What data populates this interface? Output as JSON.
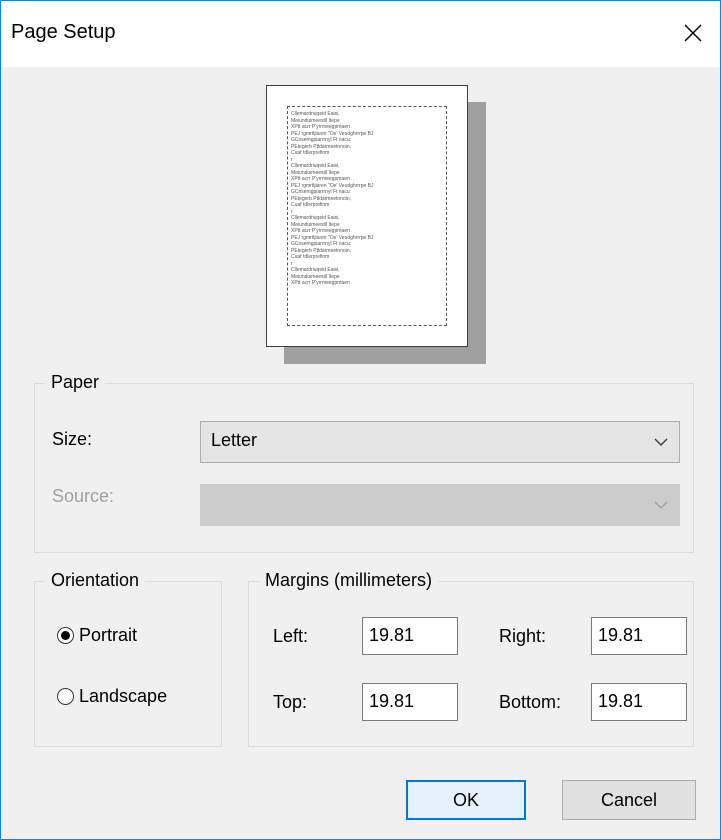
{
  "window": {
    "title": "Page Setup"
  },
  "preview": {
    "sample_lines": [
      "Cllemardriuqeid Eaisi,",
      "Meiunduimeestil Itepe",
      "XPtt acrr P'yrrmeegpmaen",
      "PEJ rgmrtljiaren \"Oe' Veudghrrrpe BJ",
      "GCnsemgpiarrrnyl Ft nacu:",
      "PEtegerb Ptldarmeetnnoin,",
      "Cuaf Idlerprefinm",
      "r",
      "Cllemardriuqeid Eaisi,",
      "Meiunduimeestil Itepe",
      "XPtt acrr P'yrrmeegpmaen",
      "PEJ rgmrtljiaren \"Oe' Veudghrrrpe BJ",
      "GCnsemgpiarrrnyl Ft nacu:",
      "PEtegerb Ptldarmeetnnoin,",
      "Cuaf Idlerprefinm",
      "r",
      "Cllemardriuqeid Eaisi,",
      "Meiunduimeestil Itepe",
      "XPtt acrr P'yrrmeegpmaen",
      "PEJ rgmrtljiaren \"Oe' Veudghrrrpe BJ",
      "GCnsemgpiarrrnyl Ft nacu:",
      "PEtegerb Ptldarmeetnnoin,",
      "Cuaf Idlerprefinm",
      "r",
      "Cllemardriuqeid Eaisi,",
      "Meiunduimeestil Itepe",
      "XPtt acrr P'yrrmeegpmaen"
    ]
  },
  "paper": {
    "legend": "Paper",
    "size_label": "Size:",
    "size_value": "Letter",
    "source_label": "Source:",
    "source_value": ""
  },
  "orientation": {
    "legend": "Orientation",
    "portrait_label": "Portrait",
    "landscape_label": "Landscape",
    "selected": "portrait"
  },
  "margins": {
    "legend": "Margins (millimeters)",
    "left_label": "Left:",
    "left_value": "19.81",
    "right_label": "Right:",
    "right_value": "19.81",
    "top_label": "Top:",
    "top_value": "19.81",
    "bottom_label": "Bottom:",
    "bottom_value": "19.81"
  },
  "buttons": {
    "ok": "OK",
    "cancel": "Cancel"
  },
  "colors": {
    "accent": "#0078d7",
    "window_border": "#1883d7",
    "dialog_bg": "#f0f0f0"
  },
  "icons": {
    "close": "close-icon",
    "dropdown": "chevron-down-icon"
  }
}
